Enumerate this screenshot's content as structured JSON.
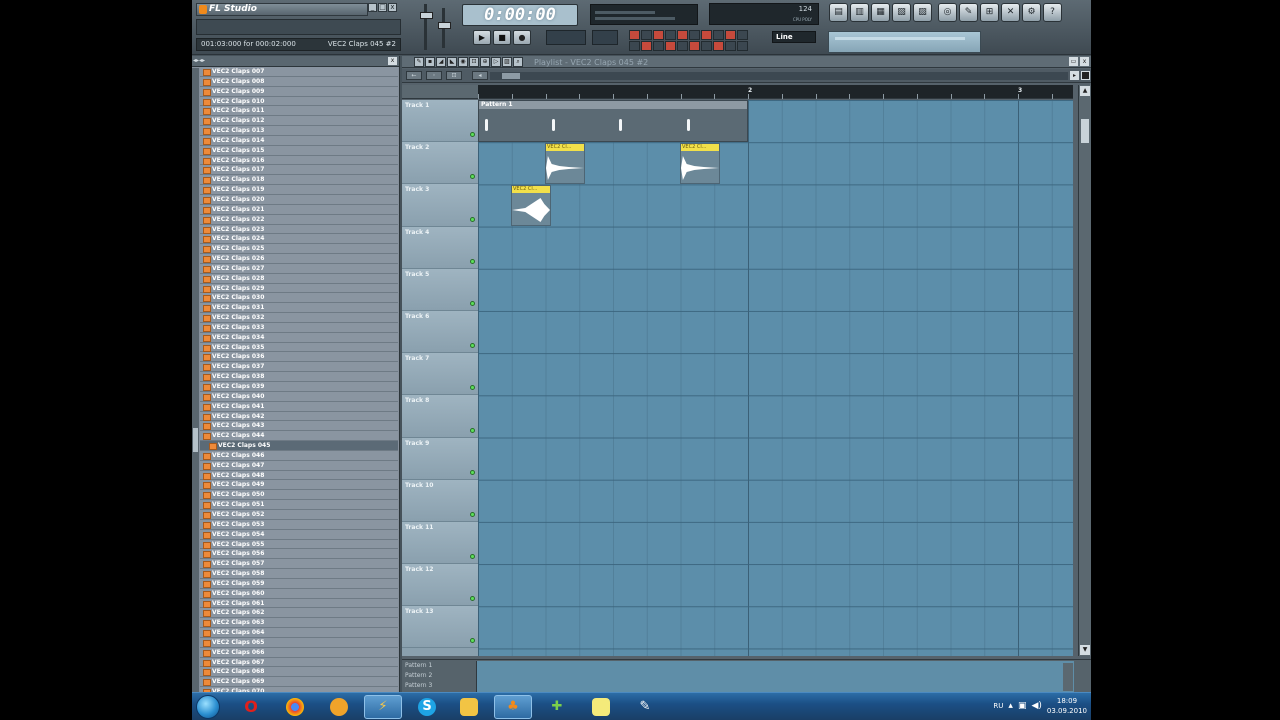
{
  "app": {
    "logo": "FL Studio",
    "status_left": "001:03:000 for 000:02:000",
    "status_right": "VEC2 Claps 045 #2",
    "time": "0:00:00",
    "cpu_label": "CPU  POLY",
    "cpu_value": "124",
    "snap": "Line",
    "window_buttons": [
      "_",
      "□",
      "x"
    ]
  },
  "browser": {
    "items": [
      "VEC2 Claps 007",
      "VEC2 Claps 008",
      "VEC2 Claps 009",
      "VEC2 Claps 010",
      "VEC2 Claps 011",
      "VEC2 Claps 012",
      "VEC2 Claps 013",
      "VEC2 Claps 014",
      "VEC2 Claps 015",
      "VEC2 Claps 016",
      "VEC2 Claps 017",
      "VEC2 Claps 018",
      "VEC2 Claps 019",
      "VEC2 Claps 020",
      "VEC2 Claps 021",
      "VEC2 Claps 022",
      "VEC2 Claps 023",
      "VEC2 Claps 024",
      "VEC2 Claps 025",
      "VEC2 Claps 026",
      "VEC2 Claps 027",
      "VEC2 Claps 028",
      "VEC2 Claps 029",
      "VEC2 Claps 030",
      "VEC2 Claps 031",
      "VEC2 Claps 032",
      "VEC2 Claps 033",
      "VEC2 Claps 034",
      "VEC2 Claps 035",
      "VEC2 Claps 036",
      "VEC2 Claps 037",
      "VEC2 Claps 038",
      "VEC2 Claps 039",
      "VEC2 Claps 040",
      "VEC2 Claps 041",
      "VEC2 Claps 042",
      "VEC2 Claps 043",
      "VEC2 Claps 044",
      "VEC2 Claps 045",
      "VEC2 Claps 046",
      "VEC2 Claps 047",
      "VEC2 Claps 048",
      "VEC2 Claps 049",
      "VEC2 Claps 050",
      "VEC2 Claps 051",
      "VEC2 Claps 052",
      "VEC2 Claps 053",
      "VEC2 Claps 054",
      "VEC2 Claps 055",
      "VEC2 Claps 056",
      "VEC2 Claps 057",
      "VEC2 Claps 058",
      "VEC2 Claps 059",
      "VEC2 Claps 060",
      "VEC2 Claps 061",
      "VEC2 Claps 062",
      "VEC2 Claps 063",
      "VEC2 Claps 064",
      "VEC2 Claps 065",
      "VEC2 Claps 066",
      "VEC2 Claps 067",
      "VEC2 Claps 068",
      "VEC2 Claps 069",
      "VEC2 Claps 070"
    ],
    "selected": "VEC2 Claps 045"
  },
  "playlist": {
    "title": "Playlist - VEC2 Claps 045 #2",
    "ruler_bars": [
      "2",
      "3"
    ],
    "tracks": [
      "Track 1",
      "Track 2",
      "Track 3",
      "Track 4",
      "Track 5",
      "Track 6",
      "Track 7",
      "Track 8",
      "Track 9",
      "Track 10",
      "Track 11",
      "Track 12",
      "Track 13"
    ],
    "pattern_clip_label": "Pattern 1",
    "audio_clip_label": "VEC2 Cl...",
    "pattern_list": [
      "Pattern 1",
      "Pattern 2",
      "Pattern 3"
    ]
  },
  "taskbar": {
    "apps": [
      "start-orb",
      "opera",
      "chrome",
      "vlc",
      "winamp",
      "skype",
      "explorer",
      "fl-studio",
      "utorrent",
      "folder",
      "paint"
    ],
    "lang": "RU",
    "time": "18:09",
    "date": "03.09.2010"
  }
}
